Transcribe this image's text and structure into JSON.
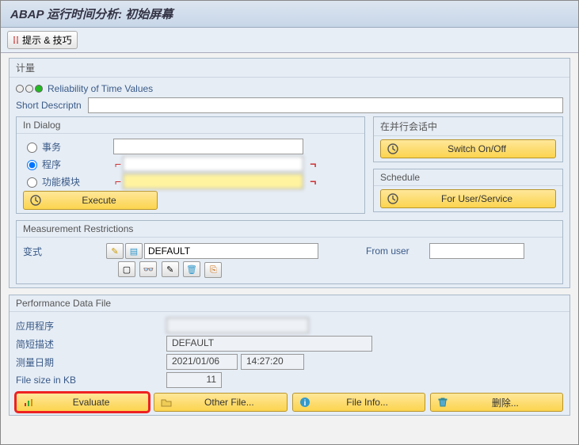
{
  "title": "ABAP 运行时间分析: 初始屏幕",
  "toolbar": {
    "tips_label": "提示 & 技巧"
  },
  "measurement_group": {
    "title": "计量",
    "reliability_label": "Reliability of Time Values",
    "short_desc_label": "Short Descriptn",
    "short_desc_value": ""
  },
  "in_dialog": {
    "title": "In Dialog",
    "radio_tx": "事务",
    "radio_prog": "程序",
    "radio_fm": "功能模块",
    "tx_value": "",
    "prog_value": "",
    "fm_value": "",
    "execute_label": "Execute"
  },
  "parallel": {
    "title": "在并行会话中",
    "switch_label": "Switch On/Off"
  },
  "schedule": {
    "title": "Schedule",
    "for_user_label": "For User/Service"
  },
  "restrictions": {
    "title": "Measurement Restrictions",
    "variant_label": "变式",
    "variant_value": "DEFAULT",
    "from_user_label": "From user",
    "from_user_value": ""
  },
  "perf": {
    "title": "Performance Data File",
    "app_label": "应用程序",
    "app_value": "",
    "desc_label": "简短描述",
    "desc_value": "DEFAULT",
    "date_label": "测量日期",
    "date_value": "2021/01/06",
    "time_value": "14:27:20",
    "size_label": "File size in KB",
    "size_value": "11",
    "evaluate_label": "Evaluate",
    "other_file_label": "Other File...",
    "file_info_label": "File Info...",
    "delete_label": "删除..."
  }
}
